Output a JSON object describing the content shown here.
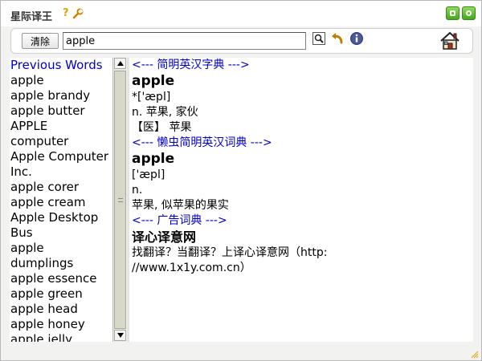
{
  "app": {
    "title": "星际译王"
  },
  "toolbar": {
    "clear_label": "清除",
    "search_value": "apple"
  },
  "sidebar": {
    "heading": "Previous Words",
    "words": [
      "apple",
      "apple brandy",
      "apple butter",
      "APPLE",
      "computer",
      "Apple Computer",
      "Inc.",
      "apple corer",
      "apple cream",
      "Apple Desktop",
      "Bus",
      "apple",
      "dumplings",
      "apple essence",
      "apple green",
      "apple head",
      "apple honey",
      "apple jelly"
    ]
  },
  "content": {
    "dict1": {
      "header": "<--- 简明英汉字典 --->",
      "word": "apple",
      "phonetic": "*['æpl]",
      "definition": "n. 苹果, 家伙",
      "medical": "【医】 苹果"
    },
    "dict2": {
      "header": "<--- 懒虫简明英汉词典 --->",
      "word": "apple",
      "phonetic": "['æpl]",
      "pos": "n.",
      "definition": "苹果, 似苹果的果实"
    },
    "dict3": {
      "header": "<--- 广告词典 --->",
      "title": "译心译意网",
      "line1": "找翻译？当翻译？上译心译意网（http:",
      "line2": "//www.1x1y.com.cn）"
    }
  },
  "colors": {
    "link_blue": "#0000cc",
    "accent_green": "#45a61d",
    "help_orange": "#e6a100"
  }
}
